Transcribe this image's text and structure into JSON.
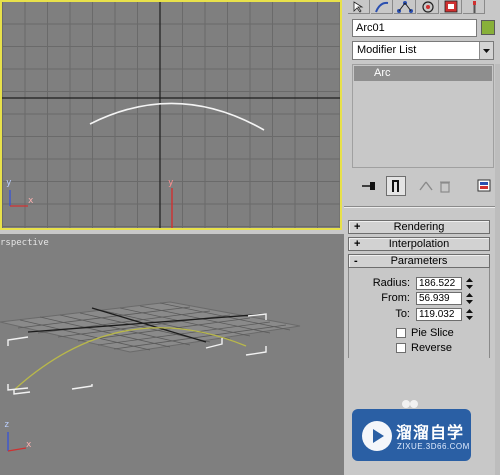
{
  "viewports": {
    "top": {
      "axis_x": "x",
      "axis_y": "y",
      "axis_y_secondary": "y"
    },
    "perspective": {
      "label": "rspective",
      "axis_x": "x",
      "axis_z": "z"
    }
  },
  "panel": {
    "tabs": [
      "create-tab",
      "modify-tab",
      "hierarchy-tab",
      "motion-tab",
      "display-tab",
      "utilities-tab"
    ],
    "object_name": "Arc01",
    "object_color": "#88b039",
    "modifier_list": "Modifier List",
    "stack": [
      "Arc"
    ],
    "rollouts": {
      "rendering": {
        "sign": "+",
        "title": "Rendering"
      },
      "interpolation": {
        "sign": "+",
        "title": "Interpolation"
      },
      "parameters": {
        "sign": "-",
        "title": "Parameters"
      }
    },
    "parameters": {
      "radius_label": "Radius:",
      "radius": "186.522",
      "from_label": "From:",
      "from": "56.939",
      "to_label": "To:",
      "to": "119.032",
      "pie_slice_label": "Pie Slice",
      "reverse_label": "Reverse"
    }
  },
  "watermark": {
    "main": "溜溜自学",
    "sub": "ZIXUE.3D66.COM"
  }
}
